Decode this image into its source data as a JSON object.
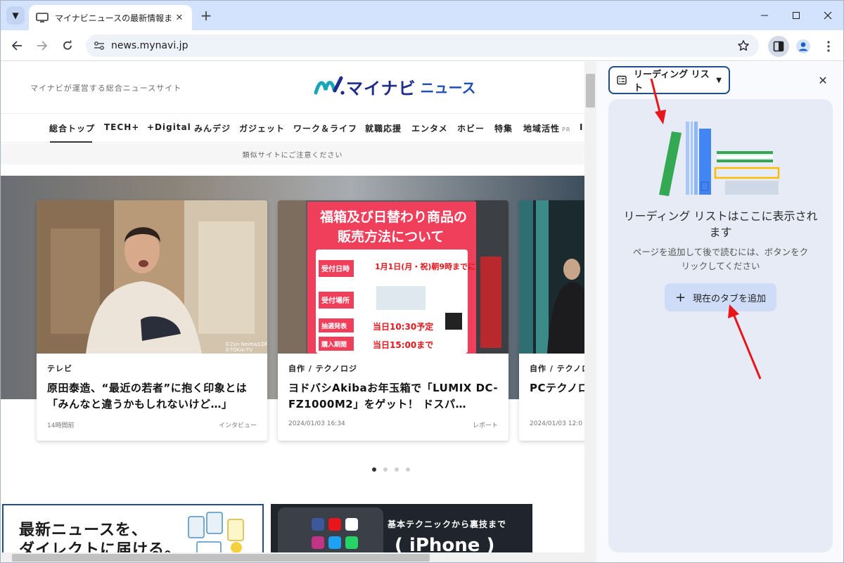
{
  "browser": {
    "tab_title": "マイナビニュースの最新情報まとめ -",
    "url": "news.mynavi.jp"
  },
  "page": {
    "site_tagline": "マイナビが運営する総合ニュースサイト",
    "logo_main": "マイナビ",
    "logo_sub": "ニュース",
    "nav": [
      "総合トップ",
      "TECH+",
      "+Digital",
      "みんデジ",
      "ガジェット",
      "ワーク＆ライフ",
      "就職応援",
      "エンタメ",
      "ホビー",
      "特集",
      "地域活性",
      "I"
    ],
    "nav_pr": "PR",
    "notice": "類似サイトにご注意ください",
    "cards": [
      {
        "category": "テレビ",
        "title": "原田泰造、“最近の若者”に抱く印象とは「みんなと違うかもしれないけど…」",
        "date": "14時間前",
        "type": "インタビュー",
        "credit": "©Zyn Neima/LDF ©TOKAI-TV"
      },
      {
        "category": "自作 / テクノロジ",
        "title": "ヨドバシAkibaお年玉箱で「LUMIX DC-FZ1000M2」をゲット！ ドスパ…",
        "date": "2024/01/03 16:34",
        "type": "レポート",
        "poster_lines": [
          "福箱及び日替わり商品の",
          "販売方法について"
        ],
        "poster_date": "1月1日(月・祝)朝9時までに",
        "poster_labels": [
          "受付日時",
          "受付場所",
          "抽選発表",
          "購入期間"
        ],
        "poster_times": [
          "当日10:30予定",
          "当日15:00まで"
        ]
      },
      {
        "category": "自作 / テクノロ",
        "title": "PCテクノロ 編",
        "date": "2024/01/03 12:0"
      }
    ],
    "banner1": [
      "最新ニュースを、",
      "ダイレクトに届ける。"
    ],
    "banner2_sub": "基本テクニックから裏技まで",
    "banner2_main": "( iPhone )"
  },
  "sidepanel": {
    "selector_label": "リーディング リスト",
    "empty_title": "リーディング リストはここに表示されます",
    "empty_desc": "ページを追加して後で読むには、ボタンをクリックしてください",
    "add_button": "現在のタブを追加"
  },
  "colors": {
    "tabstrip": "#d3e3fd",
    "annotation_arrow": "#e8161b",
    "panel_card": "#e6ebf6"
  }
}
